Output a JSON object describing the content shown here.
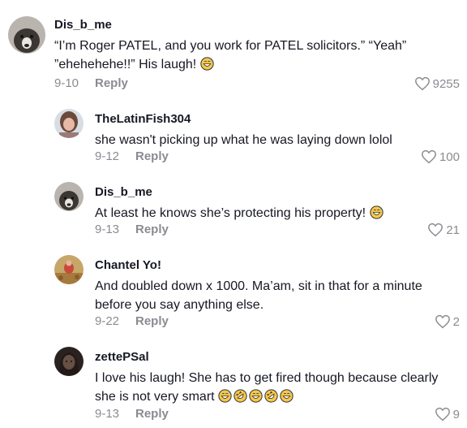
{
  "comments": [
    {
      "username": "Dis_b_me",
      "text": "“I’m Roger PATEL, and you work for PATEL solicitors.” “Yeah” ”ehehehehe!!” His laugh!",
      "emoji_count": 1,
      "date": "9-10",
      "reply_label": "Reply",
      "likes": "9255"
    },
    {
      "username": "TheLatinFish304",
      "text": "she wasn't picking up what he was laying down lolol",
      "emoji_count": 0,
      "date": "9-12",
      "reply_label": "Reply",
      "likes": "100"
    },
    {
      "username": "Dis_b_me",
      "text": "At least he knows she’s protecting his property!",
      "emoji_count": 1,
      "date": "9-13",
      "reply_label": "Reply",
      "likes": "21"
    },
    {
      "username": "Chantel Yo!",
      "text": "And doubled down x 1000. Ma’am, sit in that for a minute before you say anything else.",
      "emoji_count": 0,
      "date": "9-22",
      "reply_label": "Reply",
      "likes": "2"
    },
    {
      "username": "zettePSal",
      "text": "I love his laugh! She has to get fired though because clearly she is not very smart",
      "emoji_count": 5,
      "date": "9-13",
      "reply_label": "Reply",
      "likes": "9"
    }
  ],
  "icons": {
    "like": "heart-outline-icon",
    "emoji_1": "grinning-sweat-emoji",
    "emoji_2": "rofl-emoji"
  }
}
